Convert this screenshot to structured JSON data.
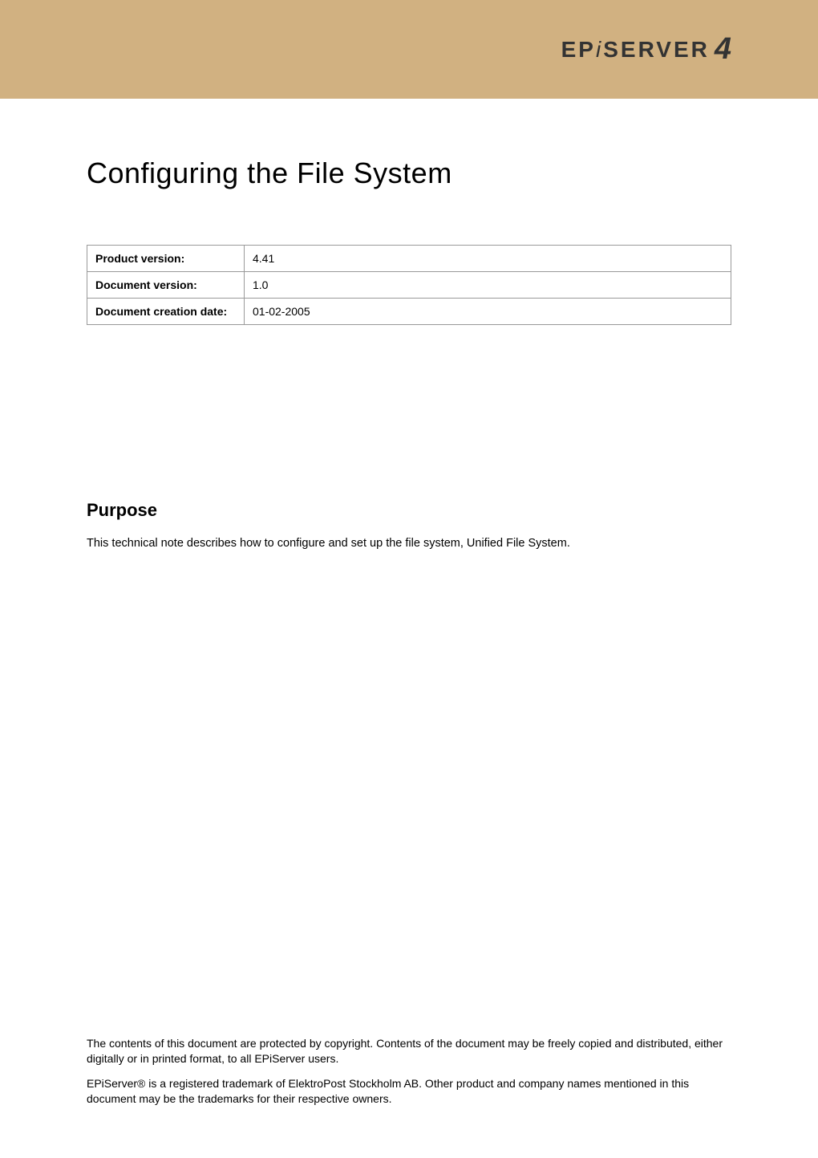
{
  "header": {
    "logo_prefix": "EP",
    "logo_mid": "i",
    "logo_suffix": "SERVER",
    "logo_number": "4"
  },
  "document": {
    "title": "Configuring the File System"
  },
  "info_table": {
    "rows": [
      {
        "label": "Product version:",
        "value": "4.41"
      },
      {
        "label": "Document version:",
        "value": "1.0"
      },
      {
        "label": "Document creation date:",
        "value": "01-02-2005"
      }
    ]
  },
  "purpose": {
    "heading": "Purpose",
    "text": "This technical note describes how to configure and set up the file system, Unified File System."
  },
  "footer": {
    "para1": "The contents of this document are protected by copyright. Contents of the document may be freely copied and distributed, either digitally or in printed format, to all EPiServer users.",
    "para2": "EPiServer® is a registered trademark of ElektroPost Stockholm AB. Other product and company names mentioned in this document may be the trademarks for their respective owners."
  }
}
